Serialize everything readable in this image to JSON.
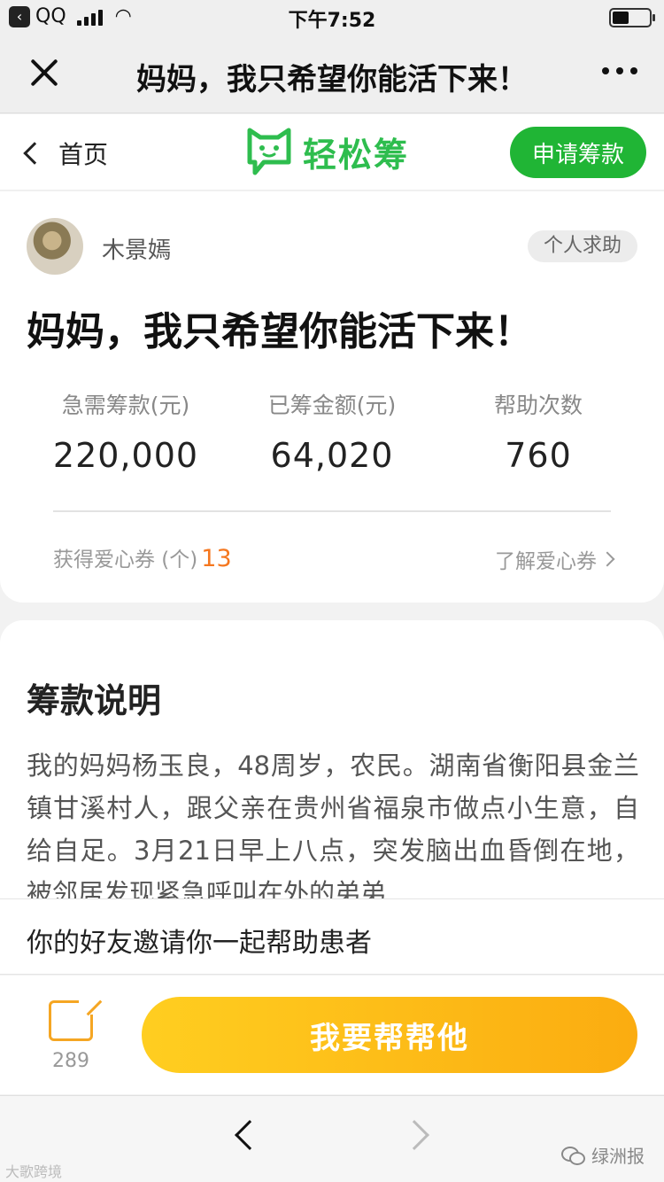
{
  "status_bar": {
    "back_app_label": "QQ",
    "time": "下午7:52",
    "battery_level": 0.45
  },
  "nav_bar": {
    "title": "妈妈，我只希望你能活下来！"
  },
  "site_header": {
    "home_label": "首页",
    "logo_text": "轻松筹",
    "apply_label": "申请筹款",
    "brand_color": "#20b535"
  },
  "campaign": {
    "author": "木景嫣",
    "tag": "个人求助",
    "title": "妈妈，我只希望你能活下来！",
    "stats": [
      {
        "label": "急需筹款(元)",
        "value": "220,000"
      },
      {
        "label": "已筹金额(元)",
        "value": "64,020"
      },
      {
        "label": "帮助次数",
        "value": "760"
      }
    ],
    "coupon_label": "获得爱心券 (个)",
    "coupon_count": "13",
    "coupon_link": "了解爱心券",
    "accent_color": "#f5771f"
  },
  "description": {
    "section_title": "筹款说明",
    "text": "我的妈妈杨玉良，48周岁，农民。湖南省衡阳县金兰镇甘溪村人，跟父亲在贵州省福泉市做点小生意，自给自足。3月21日早上八点，突发脑出血昏倒在地，被邻居发现紧急呼叫在外的弟弟"
  },
  "invite": {
    "text": "你的好友邀请你一起帮助患者"
  },
  "action_bar": {
    "share_count": "289",
    "help_label": "我要帮帮他",
    "button_color_start": "#ffce20",
    "button_color_end": "#fbac10"
  },
  "watermarks": {
    "left": "大歌跨境",
    "right": "绿洲报"
  }
}
